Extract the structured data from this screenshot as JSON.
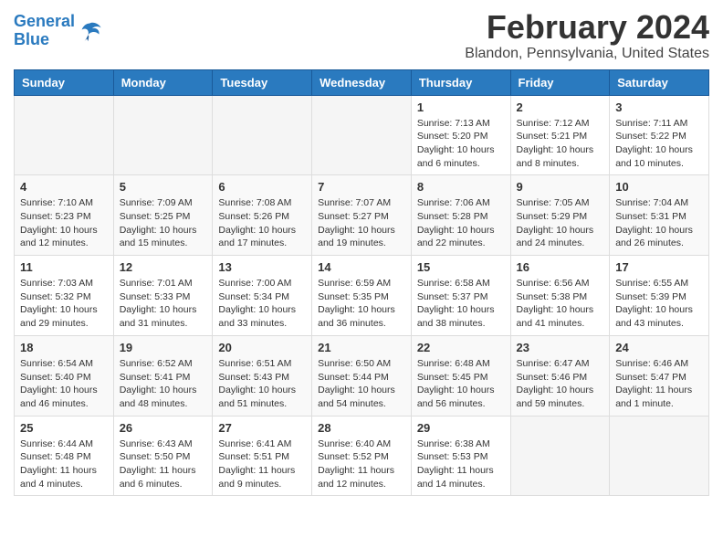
{
  "header": {
    "logo_line1": "General",
    "logo_line2": "Blue",
    "month_year": "February 2024",
    "location": "Blandon, Pennsylvania, United States"
  },
  "weekdays": [
    "Sunday",
    "Monday",
    "Tuesday",
    "Wednesday",
    "Thursday",
    "Friday",
    "Saturday"
  ],
  "weeks": [
    [
      {
        "day": "",
        "info": ""
      },
      {
        "day": "",
        "info": ""
      },
      {
        "day": "",
        "info": ""
      },
      {
        "day": "",
        "info": ""
      },
      {
        "day": "1",
        "info": "Sunrise: 7:13 AM\nSunset: 5:20 PM\nDaylight: 10 hours\nand 6 minutes."
      },
      {
        "day": "2",
        "info": "Sunrise: 7:12 AM\nSunset: 5:21 PM\nDaylight: 10 hours\nand 8 minutes."
      },
      {
        "day": "3",
        "info": "Sunrise: 7:11 AM\nSunset: 5:22 PM\nDaylight: 10 hours\nand 10 minutes."
      }
    ],
    [
      {
        "day": "4",
        "info": "Sunrise: 7:10 AM\nSunset: 5:23 PM\nDaylight: 10 hours\nand 12 minutes."
      },
      {
        "day": "5",
        "info": "Sunrise: 7:09 AM\nSunset: 5:25 PM\nDaylight: 10 hours\nand 15 minutes."
      },
      {
        "day": "6",
        "info": "Sunrise: 7:08 AM\nSunset: 5:26 PM\nDaylight: 10 hours\nand 17 minutes."
      },
      {
        "day": "7",
        "info": "Sunrise: 7:07 AM\nSunset: 5:27 PM\nDaylight: 10 hours\nand 19 minutes."
      },
      {
        "day": "8",
        "info": "Sunrise: 7:06 AM\nSunset: 5:28 PM\nDaylight: 10 hours\nand 22 minutes."
      },
      {
        "day": "9",
        "info": "Sunrise: 7:05 AM\nSunset: 5:29 PM\nDaylight: 10 hours\nand 24 minutes."
      },
      {
        "day": "10",
        "info": "Sunrise: 7:04 AM\nSunset: 5:31 PM\nDaylight: 10 hours\nand 26 minutes."
      }
    ],
    [
      {
        "day": "11",
        "info": "Sunrise: 7:03 AM\nSunset: 5:32 PM\nDaylight: 10 hours\nand 29 minutes."
      },
      {
        "day": "12",
        "info": "Sunrise: 7:01 AM\nSunset: 5:33 PM\nDaylight: 10 hours\nand 31 minutes."
      },
      {
        "day": "13",
        "info": "Sunrise: 7:00 AM\nSunset: 5:34 PM\nDaylight: 10 hours\nand 33 minutes."
      },
      {
        "day": "14",
        "info": "Sunrise: 6:59 AM\nSunset: 5:35 PM\nDaylight: 10 hours\nand 36 minutes."
      },
      {
        "day": "15",
        "info": "Sunrise: 6:58 AM\nSunset: 5:37 PM\nDaylight: 10 hours\nand 38 minutes."
      },
      {
        "day": "16",
        "info": "Sunrise: 6:56 AM\nSunset: 5:38 PM\nDaylight: 10 hours\nand 41 minutes."
      },
      {
        "day": "17",
        "info": "Sunrise: 6:55 AM\nSunset: 5:39 PM\nDaylight: 10 hours\nand 43 minutes."
      }
    ],
    [
      {
        "day": "18",
        "info": "Sunrise: 6:54 AM\nSunset: 5:40 PM\nDaylight: 10 hours\nand 46 minutes."
      },
      {
        "day": "19",
        "info": "Sunrise: 6:52 AM\nSunset: 5:41 PM\nDaylight: 10 hours\nand 48 minutes."
      },
      {
        "day": "20",
        "info": "Sunrise: 6:51 AM\nSunset: 5:43 PM\nDaylight: 10 hours\nand 51 minutes."
      },
      {
        "day": "21",
        "info": "Sunrise: 6:50 AM\nSunset: 5:44 PM\nDaylight: 10 hours\nand 54 minutes."
      },
      {
        "day": "22",
        "info": "Sunrise: 6:48 AM\nSunset: 5:45 PM\nDaylight: 10 hours\nand 56 minutes."
      },
      {
        "day": "23",
        "info": "Sunrise: 6:47 AM\nSunset: 5:46 PM\nDaylight: 10 hours\nand 59 minutes."
      },
      {
        "day": "24",
        "info": "Sunrise: 6:46 AM\nSunset: 5:47 PM\nDaylight: 11 hours\nand 1 minute."
      }
    ],
    [
      {
        "day": "25",
        "info": "Sunrise: 6:44 AM\nSunset: 5:48 PM\nDaylight: 11 hours\nand 4 minutes."
      },
      {
        "day": "26",
        "info": "Sunrise: 6:43 AM\nSunset: 5:50 PM\nDaylight: 11 hours\nand 6 minutes."
      },
      {
        "day": "27",
        "info": "Sunrise: 6:41 AM\nSunset: 5:51 PM\nDaylight: 11 hours\nand 9 minutes."
      },
      {
        "day": "28",
        "info": "Sunrise: 6:40 AM\nSunset: 5:52 PM\nDaylight: 11 hours\nand 12 minutes."
      },
      {
        "day": "29",
        "info": "Sunrise: 6:38 AM\nSunset: 5:53 PM\nDaylight: 11 hours\nand 14 minutes."
      },
      {
        "day": "",
        "info": ""
      },
      {
        "day": "",
        "info": ""
      }
    ]
  ]
}
